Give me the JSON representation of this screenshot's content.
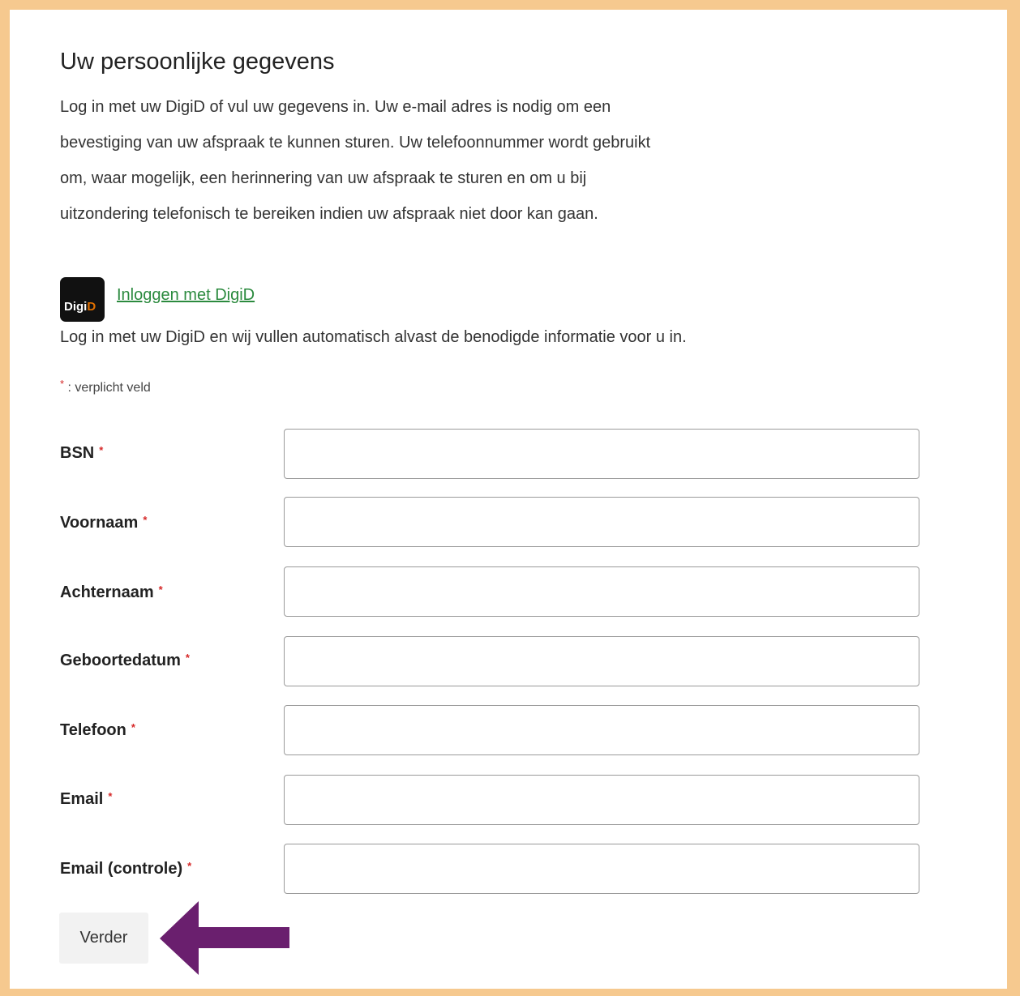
{
  "header": {
    "title": "Uw persoonlijke gegevens",
    "intro_lines": [
      "Log in met uw DigiD of vul uw gegevens in. Uw e-mail adres is nodig om een",
      "bevestiging van uw afspraak te kunnen sturen. Uw telefoonnummer wordt gebruikt",
      "om, waar mogelijk, een herinnering van uw afspraak te sturen en om u bij",
      "uitzondering telefonisch te bereiken indien uw afspraak niet door kan gaan."
    ]
  },
  "digid": {
    "logo_text_main": "Digi",
    "logo_text_accent": "D",
    "link_label": " Inloggen met DigiD",
    "description": "Log in met uw DigiD en wij vullen automatisch alvast de benodigde informatie voor u in."
  },
  "form": {
    "required_marker": "*",
    "required_note": " : verplicht veld",
    "fields": [
      {
        "label": "BSN",
        "value": ""
      },
      {
        "label": "Voornaam",
        "value": ""
      },
      {
        "label": "Achternaam",
        "value": ""
      },
      {
        "label": "Geboortedatum",
        "value": ""
      },
      {
        "label": "Telefoon",
        "value": ""
      },
      {
        "label": "Email",
        "value": ""
      },
      {
        "label": "Email (controle)",
        "value": ""
      }
    ],
    "submit_label": "Verder"
  },
  "colors": {
    "frame_border": "#f6c98f",
    "link": "#2b8a3e",
    "required_star": "#d62828",
    "annotation_arrow": "#6a1f6e"
  },
  "annotation": {
    "icon": "arrow-left-icon"
  }
}
